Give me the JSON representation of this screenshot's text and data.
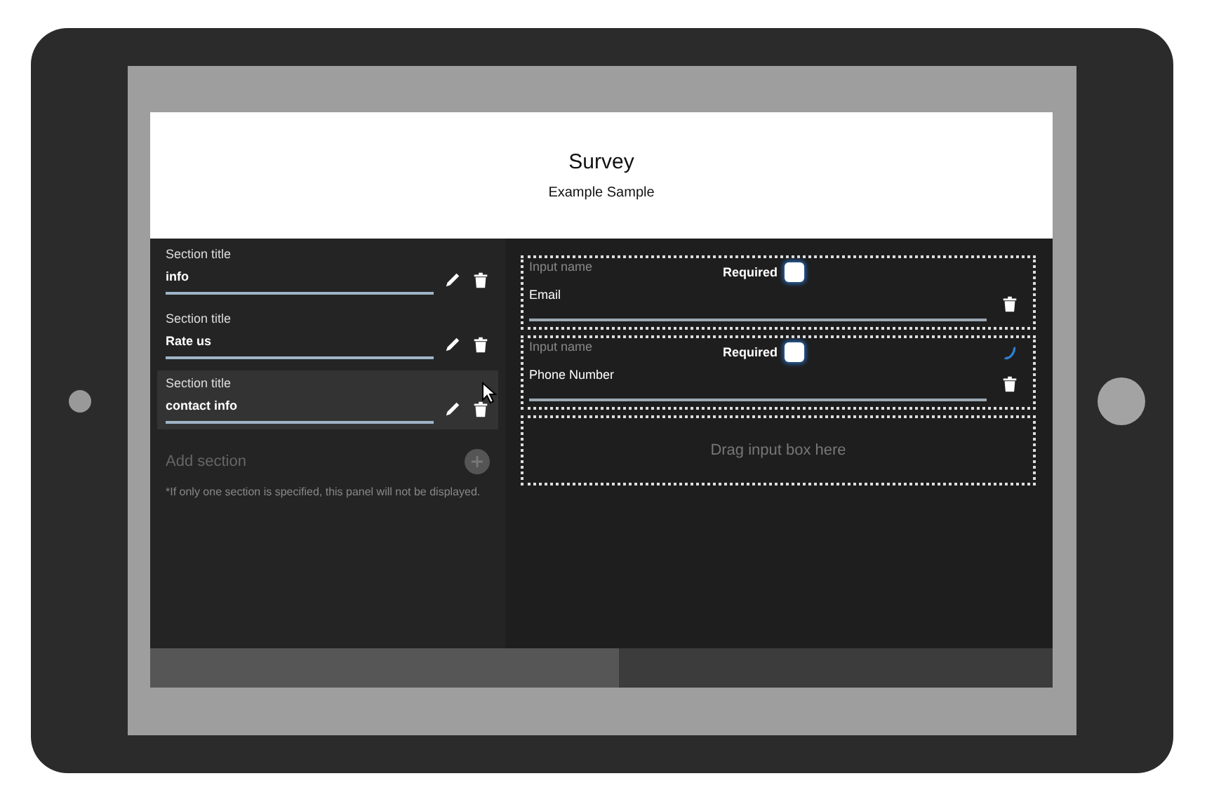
{
  "header": {
    "title": "Survey",
    "subtitle": "Example Sample"
  },
  "sections": [
    {
      "label": "Section title",
      "value": "info",
      "selected": false
    },
    {
      "label": "Section title",
      "value": "Rate us",
      "selected": false
    },
    {
      "label": "Section title",
      "value": "contact info",
      "selected": true
    }
  ],
  "add_section": {
    "label": "Add section"
  },
  "note": "*If only one section is specified, this panel will not be displayed.",
  "inputs": [
    {
      "label": "Input name",
      "required_label": "Required",
      "checked": false,
      "value": "Email",
      "kind": "text"
    },
    {
      "label": "Input name",
      "required_label": "Required",
      "checked": false,
      "value": "Phone Number",
      "kind": "phone"
    }
  ],
  "drop_zone": "Drag input box here"
}
